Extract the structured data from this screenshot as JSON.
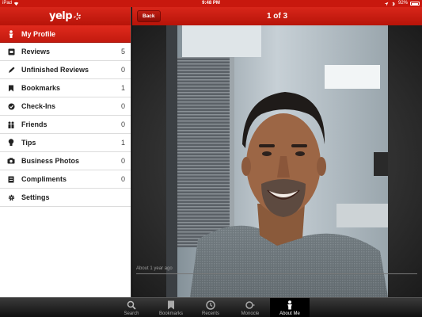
{
  "status_bar": {
    "device": "iPad",
    "time": "9:48 PM",
    "battery": "92%"
  },
  "sidebar": {
    "logo": "yelp",
    "items": [
      {
        "label": "My Profile",
        "count": "",
        "icon": "person-icon",
        "active": true
      },
      {
        "label": "Reviews",
        "count": "5",
        "icon": "reviews-icon"
      },
      {
        "label": "Unfinished Reviews",
        "count": "0",
        "icon": "pencil-icon"
      },
      {
        "label": "Bookmarks",
        "count": "1",
        "icon": "bookmark-icon"
      },
      {
        "label": "Check-Ins",
        "count": "0",
        "icon": "checkmark-icon"
      },
      {
        "label": "Friends",
        "count": "0",
        "icon": "friends-icon"
      },
      {
        "label": "Tips",
        "count": "1",
        "icon": "lightbulb-icon"
      },
      {
        "label": "Business Photos",
        "count": "0",
        "icon": "camera-icon"
      },
      {
        "label": "Compliments",
        "count": "0",
        "icon": "compliment-icon"
      },
      {
        "label": "Settings",
        "count": "",
        "icon": "gear-icon"
      }
    ]
  },
  "main": {
    "back_label": "Back",
    "page_counter": "1 of 3",
    "caption": "About 1 year ago"
  },
  "tab_bar": {
    "tabs": [
      {
        "label": "Search",
        "icon": "search-icon"
      },
      {
        "label": "Bookmarks",
        "icon": "bookmark-icon"
      },
      {
        "label": "Recents",
        "icon": "clock-icon"
      },
      {
        "label": "Monocle",
        "icon": "monocle-icon"
      },
      {
        "label": "About Me",
        "icon": "person-icon",
        "active": true
      }
    ]
  }
}
